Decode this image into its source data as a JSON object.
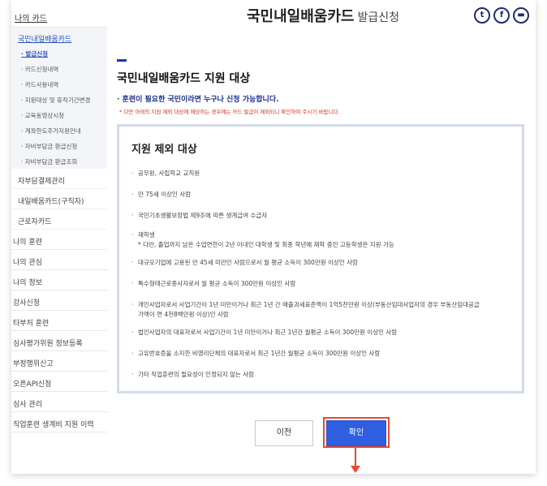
{
  "header": {
    "title": "국민내일배움카드",
    "subtitle": "발급신청",
    "social": [
      {
        "name": "twitter-icon",
        "glyph": "t"
      },
      {
        "name": "facebook-icon",
        "glyph": "f"
      },
      {
        "name": "print-icon",
        "glyph": "▬"
      }
    ]
  },
  "sidebar": {
    "top": "나의 카드",
    "sub_title": "국민내일배움카드",
    "links": [
      "· 발급신청",
      "· 카드신청내역",
      "· 카드사용내역",
      "· 지원대상 및 휴직기간변경",
      "· 교육동영상시청",
      "· 계좌한도추가지원안내",
      "· 자비부담금 환급신청",
      "· 자비부담금 환급조회"
    ],
    "items": [
      "자부담결제관리",
      "내일배움카드(구직자)",
      "근로자카드"
    ],
    "main": [
      "나의 훈련",
      "나의 관심",
      "나의 정보",
      "강사신청",
      "타부처 훈련",
      "심사평가위원 정보등록",
      "부정행위신고",
      "오픈API신청",
      "심사 관리",
      "직업훈련 생계비 지원 이력"
    ]
  },
  "main": {
    "section_title": "국민내일배움카드 지원 대상",
    "notice": "· 훈련이 필요한 국민이라면 누구나 신청 가능합니다.",
    "notice_red": "* 다만 아래의 지원 제외 대상에 해당하는 경우에는 카드 발급이 제외되니 확인하여 주시기 바랍니다.",
    "box_title": "지원 제외 대상",
    "exclusions": [
      {
        "text": "공무원, 사립학교 교직원",
        "sub": []
      },
      {
        "text": "만 75세 이상인 사람",
        "sub": []
      },
      {
        "text": "국민기초생활보장법 제9조에 따른 생계급여 수급자",
        "sub": []
      },
      {
        "text": "재학생",
        "sub": [
          "* 다만, 졸업까지 남은 수업연한이 2년 이내인 대학생 및 최종 학년에 재학 중인 고등학생은 지원 가능"
        ]
      },
      {
        "text": "대규모기업에 고용된 만 45세 미만인 사람으로서 월 평균 소득이 300만원 이상인 사람",
        "sub": []
      },
      {
        "text": "특수형태근로종사자로서 월 평균 소득이 300만원 이상인 사람",
        "sub": []
      },
      {
        "text": "개인사업자로서 사업기간이 1년 미만이거나 최근 1년 간 매출과세표준액이 1억5천만원 이상(부동산임대사업자의 경우 부동산임대공급",
        "sub": [
          "가액이 연 4천8백만원 이상)인 사람"
        ]
      },
      {
        "text": "법인사업자의 대표자로서 사업기간이 1년 미만이거나 최근 1년간 월평균 소득이 300만원 이상인 사람",
        "sub": []
      },
      {
        "text": "고유번호증을 소지한 비영리단체의 대표자로서 최근 1년간 월평균 소득이 300만원 이상인 사람",
        "sub": []
      },
      {
        "text": "기타 직업훈련의 필요성이 인정되지 않는 사람",
        "sub": []
      }
    ]
  },
  "buttons": {
    "prev": "이전",
    "confirm": "확인"
  },
  "colors": {
    "accent": "#2f5fe0",
    "highlight": "#e8492e",
    "notice_red": "#d0341e",
    "nav_blue": "#2a55b8"
  }
}
